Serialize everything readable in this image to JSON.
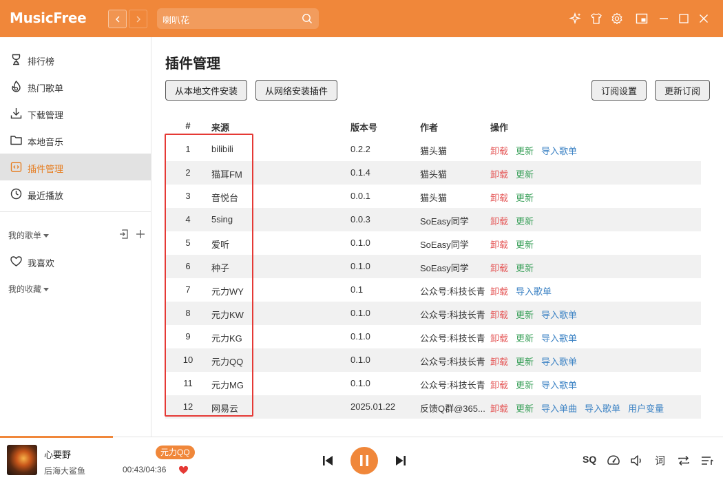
{
  "app": {
    "name": "MusicFree"
  },
  "search": {
    "value": "喇叭花"
  },
  "sidebar": {
    "items": [
      {
        "label": "排行榜",
        "icon": "trophy-icon"
      },
      {
        "label": "热门歌单",
        "icon": "fire-icon"
      },
      {
        "label": "下载管理",
        "icon": "download-icon"
      },
      {
        "label": "本地音乐",
        "icon": "folder-icon"
      },
      {
        "label": "插件管理",
        "icon": "plugin-icon",
        "active": true
      },
      {
        "label": "最近播放",
        "icon": "clock-icon"
      }
    ],
    "my_playlists": "我的歌单",
    "favorites": "我喜欢",
    "my_collections": "我的收藏"
  },
  "main": {
    "title": "插件管理",
    "buttons": {
      "install_local": "从本地文件安装",
      "install_network": "从网络安装插件",
      "subscription_settings": "订阅设置",
      "update_subscription": "更新订阅"
    },
    "columns": {
      "index": "#",
      "source": "来源",
      "version": "版本号",
      "author": "作者",
      "actions": "操作"
    },
    "plugins": [
      {
        "index": "1",
        "source": "bilibili",
        "version": "0.2.2",
        "author": "猫头猫",
        "actions": [
          "卸载",
          "更新",
          "导入歌单"
        ]
      },
      {
        "index": "2",
        "source": "猫耳FM",
        "version": "0.1.4",
        "author": "猫头猫",
        "actions": [
          "卸载",
          "更新"
        ]
      },
      {
        "index": "3",
        "source": "音悦台",
        "version": "0.0.1",
        "author": "猫头猫",
        "actions": [
          "卸载",
          "更新"
        ]
      },
      {
        "index": "4",
        "source": "5sing",
        "version": "0.0.3",
        "author": "SoEasy同学",
        "actions": [
          "卸载",
          "更新"
        ]
      },
      {
        "index": "5",
        "source": "爱听",
        "version": "0.1.0",
        "author": "SoEasy同学",
        "actions": [
          "卸载",
          "更新"
        ]
      },
      {
        "index": "6",
        "source": "种子",
        "version": "0.1.0",
        "author": "SoEasy同学",
        "actions": [
          "卸载",
          "更新"
        ]
      },
      {
        "index": "7",
        "source": "元力WY",
        "version": "0.1",
        "author": "公众号:科技长青",
        "actions": [
          "卸载",
          "导入歌单"
        ]
      },
      {
        "index": "8",
        "source": "元力KW",
        "version": "0.1.0",
        "author": "公众号:科技长青",
        "actions": [
          "卸载",
          "更新",
          "导入歌单"
        ]
      },
      {
        "index": "9",
        "source": "元力KG",
        "version": "0.1.0",
        "author": "公众号:科技长青",
        "actions": [
          "卸载",
          "更新",
          "导入歌单"
        ]
      },
      {
        "index": "10",
        "source": "元力QQ",
        "version": "0.1.0",
        "author": "公众号:科技长青",
        "actions": [
          "卸载",
          "更新",
          "导入歌单"
        ]
      },
      {
        "index": "11",
        "source": "元力MG",
        "version": "0.1.0",
        "author": "公众号:科技长青",
        "actions": [
          "卸载",
          "更新",
          "导入歌单"
        ]
      },
      {
        "index": "12",
        "source": "网易云",
        "version": "2025.01.22",
        "author": "反馈Q群@365...",
        "actions": [
          "卸载",
          "更新",
          "导入单曲",
          "导入歌单",
          "用户变量"
        ]
      }
    ]
  },
  "player": {
    "title": "心要野",
    "artist": "后海大鲨鱼",
    "source_tag": "元力QQ",
    "time": "00:43/04:36",
    "progress": 0.156,
    "quality": "SQ",
    "lyric_label": "词"
  },
  "colors": {
    "accent": "#f0873a",
    "uninstall": "#e55a5a",
    "update": "#3aa05a",
    "import": "#3b82c4",
    "highlight_box": "#e53935"
  }
}
